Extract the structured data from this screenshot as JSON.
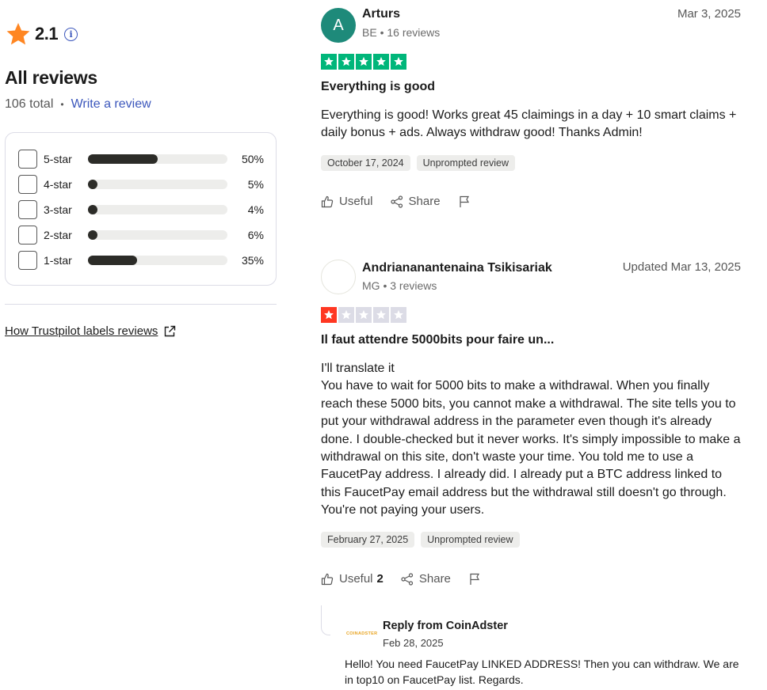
{
  "summary": {
    "rating": "2.1",
    "heading": "All reviews",
    "total": "106 total",
    "write_link": "Write a review",
    "star_color": "#ff8622",
    "distribution": [
      {
        "label": "5-star",
        "percent_text": "50%",
        "value": 50
      },
      {
        "label": "4-star",
        "percent_text": "5%",
        "value": 5
      },
      {
        "label": "3-star",
        "percent_text": "4%",
        "value": 4
      },
      {
        "label": "2-star",
        "percent_text": "6%",
        "value": 6
      },
      {
        "label": "1-star",
        "percent_text": "35%",
        "value": 35
      }
    ],
    "labels_link": "How Trustpilot labels reviews"
  },
  "reviews": [
    {
      "avatar_letter": "A",
      "avatar_color": "#1e8a7a",
      "name": "Arturs",
      "meta": "BE • 16 reviews",
      "date": "Mar 3, 2025",
      "stars": 5,
      "star_color": "#00b67a",
      "title": "Everything is good",
      "body": "Everything is good! Works great 45 claimings in a day + 10 smart claims + daily bonus + ads. Always withdraw good! Thanks Admin!",
      "experience_date": "October 17, 2024",
      "tag": "Unprompted review",
      "useful_label": "Useful",
      "useful_count": "",
      "share_label": "Share"
    },
    {
      "avatar_letter": "",
      "avatar_color": "#ffffff",
      "name": "Andriananantenaina Tsikisariak",
      "meta": "MG • 3 reviews",
      "date": "Updated Mar 13, 2025",
      "stars": 1,
      "star_color": "#ff3722",
      "title": "Il faut attendre 5000bits pour faire un...",
      "body": "I'll translate it\nYou have to wait for 5000 bits to make a withdrawal. When you finally reach these 5000 bits, you cannot make a withdrawal. The site tells you to put your withdrawal address in the parameter even though it's already done. I double-checked but it never works. It's simply impossible to make a withdrawal on this site, don't waste your time. You told me to use a FaucetPay address. I already did. I already put a BTC address linked to this FaucetPay email address but the withdrawal still doesn't go through. You're not paying your users.",
      "experience_date": "February 27, 2025",
      "tag": "Unprompted review",
      "useful_label": "Useful",
      "useful_count": "2",
      "share_label": "Share"
    }
  ],
  "reply": {
    "logo_text": "COINADSTER",
    "from": "Reply from CoinAdster",
    "date": "Feb 28, 2025",
    "body": "Hello! You need FaucetPay LINKED ADDRESS! Then you can withdraw. We are in top10 on FaucetPay list. Regards."
  }
}
